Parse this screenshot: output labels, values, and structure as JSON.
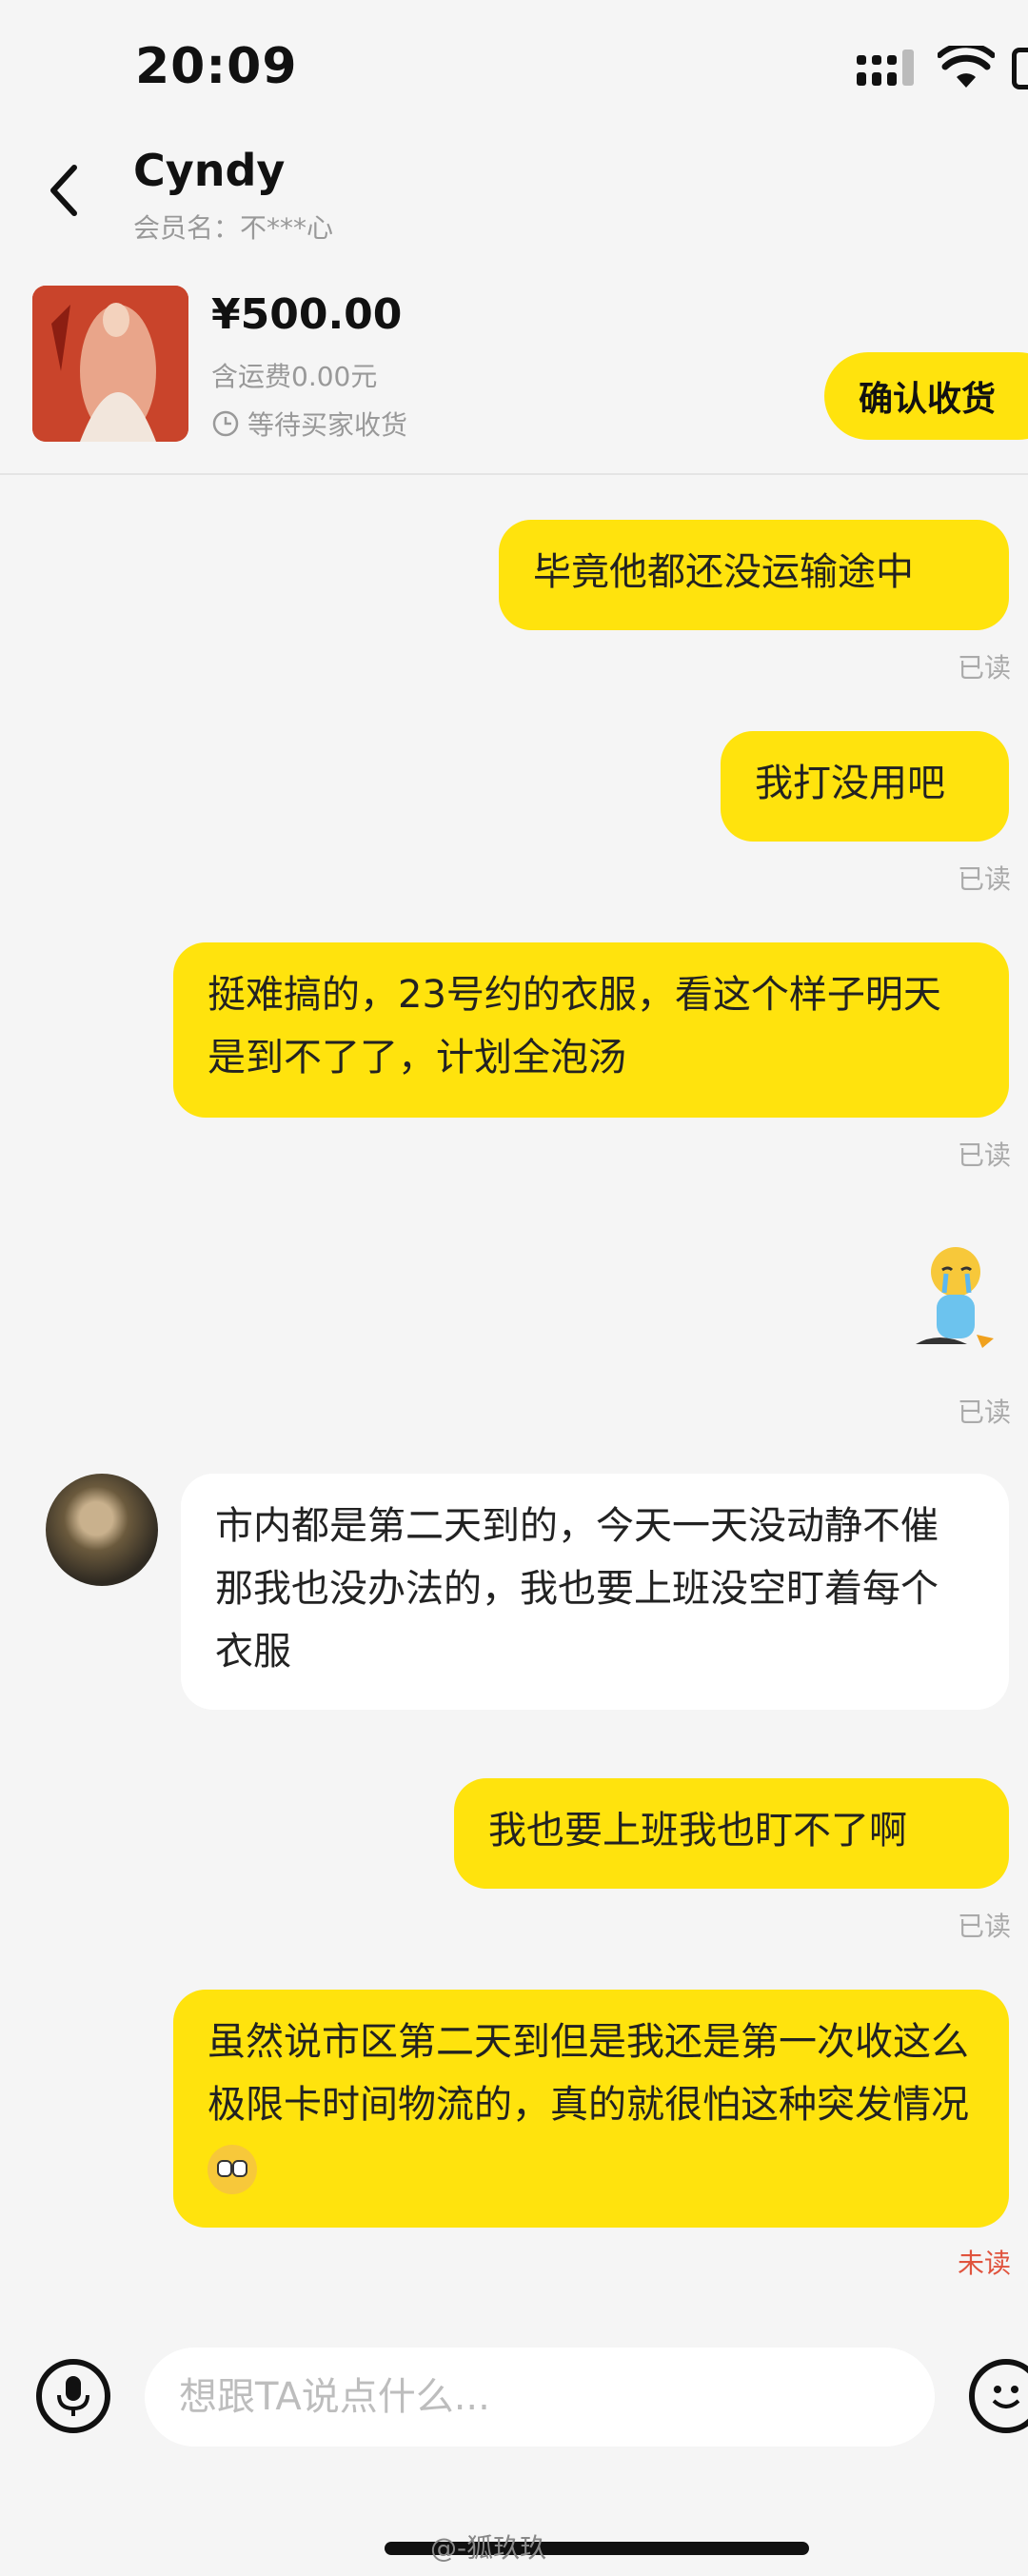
{
  "status_bar": {
    "time": "20:09"
  },
  "header": {
    "title": "Cyndy",
    "member_line": "会员名：不***心"
  },
  "product": {
    "price": "¥500.00",
    "shipping": "含运费0.00元",
    "status": "等待买家收货",
    "confirm_label": "确认收货"
  },
  "messages": [
    {
      "text": "毕竟他都还没运输途中",
      "receipt": "已读"
    },
    {
      "text": "我打没用吧",
      "receipt": "已读"
    },
    {
      "text": "挺难搞的，23号约的衣服，看这个样子明天是到不了了，计划全泡汤",
      "receipt": "已读"
    },
    {
      "receipt": "已读"
    },
    {
      "text": "市内都是第二天到的，今天一天没动静不催那我也没办法的，我也要上班没空盯着每个衣服"
    },
    {
      "text": "我也要上班我也盯不了啊",
      "receipt": "已读"
    },
    {
      "text": "虽然说市区第二天到但是我还是第一次收这么极限卡时间物流的，真的就很怕这种突发情况",
      "receipt": "未读"
    }
  ],
  "input": {
    "placeholder": "想跟TA说点什么..."
  },
  "watermark": "@-狐玖玖",
  "colors": {
    "accent": "#ffe30d",
    "unread": "#e0533d"
  }
}
